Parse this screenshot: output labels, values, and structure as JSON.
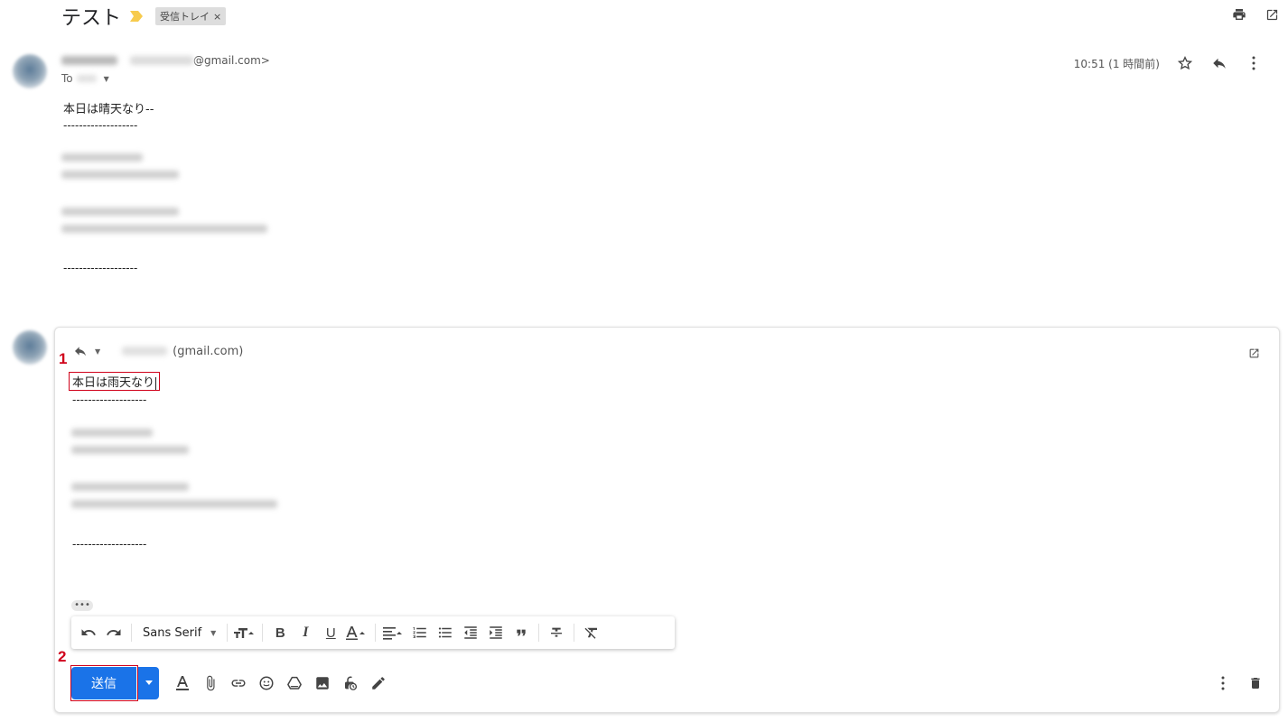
{
  "thread": {
    "subject": "テスト",
    "label": "受信トレイ",
    "label_remove": "×"
  },
  "top_icons": [
    "print-icon",
    "open-in-new-window-icon"
  ],
  "message": {
    "from_domain": "@gmail.com>",
    "to_prefix": "To",
    "time": "10:51 (1 時間前)",
    "body_line": "本日は晴天なり--",
    "separator": "-------------------",
    "separator2": "-------------------"
  },
  "reply": {
    "recipient_domain": "(gmail.com)",
    "text": "本日は雨天なり",
    "separator": "-------------------",
    "separator2": "-------------------",
    "more": "•••"
  },
  "format_bar": {
    "font": "Sans Serif",
    "buttons": [
      "undo-icon",
      "redo-icon",
      "font-select",
      "text-size-icon",
      "bold-icon",
      "italic-icon",
      "underline-icon",
      "text-color-icon",
      "align-icon",
      "numbered-list-icon",
      "bulleted-list-icon",
      "indent-less-icon",
      "indent-more-icon",
      "quote-icon",
      "strikethrough-icon",
      "remove-formatting-icon"
    ]
  },
  "compose_actions": {
    "send_label": "送信"
  },
  "annotations": {
    "step1": "1",
    "step2": "2"
  },
  "colors": {
    "accent": "#1a73e8",
    "annotation": "#d0021b",
    "importance": "#f7cb4d"
  }
}
